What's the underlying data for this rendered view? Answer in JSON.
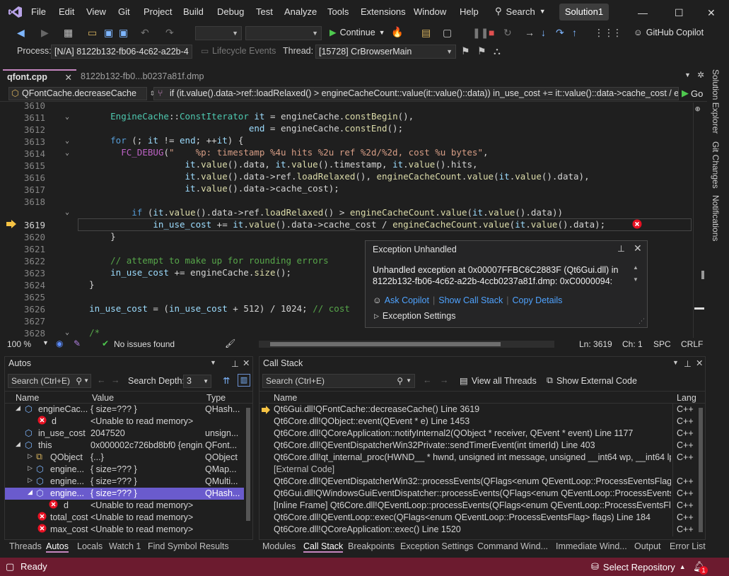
{
  "menu": {
    "items": [
      "File",
      "Edit",
      "View",
      "Git",
      "Project",
      "Build",
      "Debug",
      "Test",
      "Analyze",
      "Tools",
      "Extensions",
      "Window",
      "Help"
    ],
    "search_label": "Search",
    "solution": "Solution1"
  },
  "toolbar": {
    "continue_label": "Continue",
    "copilot_label": "GitHub Copilot"
  },
  "debug_location": {
    "process_label": "Process:",
    "process_value": "[N/A] 8122b132-fb06-4c62-a22b-4",
    "lifecycle_label": "Lifecycle Events",
    "thread_label": "Thread:",
    "thread_value": "[15728] CrBrowserMain"
  },
  "tabs": {
    "active": "qfont.cpp",
    "second": "8122b132-fb0...b0237a81f.dmp"
  },
  "navbar": {
    "scope": "QFontCache.decreaseCache",
    "expr": "if (it.value().data->ref::loadRelaxed() > engineCacheCount::value(it::value()::data)) in_use_cost += it::value()::data->cache_cost / engi",
    "go": "Go"
  },
  "editor": {
    "lines": [
      "3610",
      "3611",
      "3612",
      "3613",
      "3614",
      "3615",
      "3616",
      "3617",
      "3618",
      "3619",
      "3620",
      "3621",
      "3622",
      "3623",
      "3624",
      "3625",
      "3626",
      "3627",
      "3628"
    ],
    "current_line": "3619"
  },
  "exception": {
    "title": "Exception Unhandled",
    "message": "Unhandled exception at 0x00007FFBC6C2883F (Qt6Gui.dll) in 8122b132-fb06-4c62-a22b-4ccb0237a81f.dmp: 0xC0000094:",
    "ask_copilot": "Ask Copilot",
    "show_call_stack": "Show Call Stack",
    "copy_details": "Copy Details",
    "settings": "Exception Settings"
  },
  "editor_status": {
    "zoom": "100 %",
    "issues": "No issues found",
    "ln": "Ln: 3619",
    "ch": "Ch: 1",
    "spc": "SPC",
    "eol": "CRLF"
  },
  "autos": {
    "title": "Autos",
    "search_placeholder": "Search (Ctrl+E)",
    "depth_label": "Search Depth:",
    "depth_value": "3",
    "columns": [
      "Name",
      "Value",
      "Type"
    ],
    "rows": [
      {
        "name": "engineCac...",
        "value": "{ size=??? }",
        "type": "QHash..."
      },
      {
        "name": "d",
        "value": "<Unable to read memory>",
        "type": ""
      },
      {
        "name": "in_use_cost",
        "value": "2047520",
        "type": "unsign..."
      },
      {
        "name": "this",
        "value": "0x000002c726bd8bf0 {engin...",
        "type": "QFont..."
      },
      {
        "name": "QObject",
        "value": "{...}",
        "type": "QObject"
      },
      {
        "name": "engine...",
        "value": "{ size=??? }",
        "type": "QMap..."
      },
      {
        "name": "engine...",
        "value": "{ size=??? }",
        "type": "QMulti..."
      },
      {
        "name": "engine...",
        "value": "{ size=??? }",
        "type": "QHash..."
      },
      {
        "name": "d",
        "value": "<Unable to read memory>",
        "type": ""
      },
      {
        "name": "total_cost",
        "value": "<Unable to read memory>",
        "type": ""
      },
      {
        "name": "max_cost",
        "value": "<Unable to read memory>",
        "type": ""
      }
    ],
    "tabs": [
      "Threads",
      "Autos",
      "Locals",
      "Watch 1",
      "Find Symbol Results"
    ]
  },
  "callstack": {
    "title": "Call Stack",
    "search_placeholder": "Search (Ctrl+E)",
    "view_all_threads": "View all Threads",
    "show_external": "Show External Code",
    "columns": [
      "Name",
      "Lang"
    ],
    "rows": [
      {
        "name": "Qt6Gui.dll!QFontCache::decreaseCache() Line 3619",
        "lang": "C++"
      },
      {
        "name": "Qt6Core.dll!QObject::event(QEvent * e) Line 1453",
        "lang": "C++"
      },
      {
        "name": "Qt6Core.dll!QCoreApplication::notifyInternal2(QObject * receiver, QEvent * event) Line 1177",
        "lang": "C++"
      },
      {
        "name": "Qt6Core.dll!QEventDispatcherWin32Private::sendTimerEvent(int timerId) Line 403",
        "lang": "C++"
      },
      {
        "name": "Qt6Core.dll!qt_internal_proc(HWND__ * hwnd, unsigned int message, unsigned __int64 wp, __int64 lp) Lin...",
        "lang": "C++"
      },
      {
        "name": "[External Code]",
        "lang": ""
      },
      {
        "name": "Qt6Core.dll!QEventDispatcherWin32::processEvents(QFlags<enum QEventLoop::ProcessEventsFlag> flags...",
        "lang": "C++"
      },
      {
        "name": "Qt6Gui.dll!QWindowsGuiEventDispatcher::processEvents(QFlags<enum QEventLoop::ProcessEventsFlag> flags...",
        "lang": "C++"
      },
      {
        "name": "[Inline Frame] Qt6Core.dll!QEventLoop::processEvents(QFlags<enum QEventLoop::ProcessEventsFlag> fl...",
        "lang": "C++"
      },
      {
        "name": "Qt6Core.dll!QEventLoop::exec(QFlags<enum QEventLoop::ProcessEventsFlag> flags) Line 184",
        "lang": "C++"
      },
      {
        "name": "Qt6Core.dll!QCoreApplication::exec() Line 1520",
        "lang": "C++"
      }
    ],
    "tabs": [
      "Modules",
      "Call Stack",
      "Breakpoints",
      "Exception Settings",
      "Command Wind...",
      "Immediate Wind...",
      "Output",
      "Error List"
    ]
  },
  "side_tabs": [
    "Solution Explorer",
    "Git Changes",
    "Notifications"
  ],
  "statusbar": {
    "ready": "Ready",
    "repo": "Select Repository",
    "notif_count": "1",
    "color": "#6c1b2f"
  }
}
